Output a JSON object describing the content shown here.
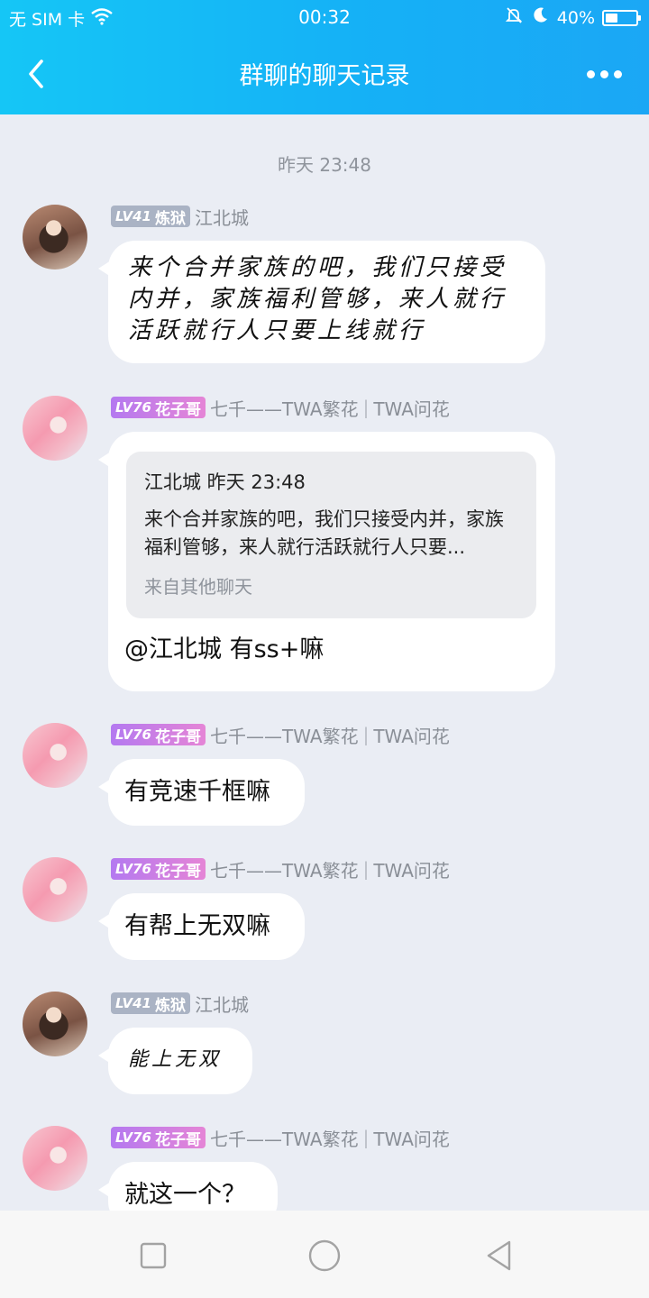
{
  "status_bar": {
    "carrier": "无 SIM 卡",
    "time": "00:32",
    "battery": "40%",
    "battery_level": 0.4
  },
  "nav": {
    "title": "群聊的聊天记录",
    "back_icon": "chevron-left-icon",
    "more_icon": "more-dots-icon"
  },
  "chat": {
    "time_separator": "昨天 23:48",
    "messages": [
      {
        "level": "LV41",
        "badge_name": "炼狱",
        "sender": "江北城",
        "text": "来个合并家族的吧，我们只接受内并，家族福利管够，来人就行活跃就行人只要上线就行"
      },
      {
        "level": "LV76",
        "badge_name": "花子哥",
        "sender": "七千——TWA繁花",
        "sender_extra": "TWA问花",
        "quote": {
          "header": "江北城 昨天 23:48",
          "body": "来个合并家族的吧，我们只接受内并，家族福利管够，来人就行活跃就行人只要...",
          "source": "来自其他聊天"
        },
        "text": "@江北城 有ss+嘛"
      },
      {
        "level": "LV76",
        "badge_name": "花子哥",
        "sender": "七千——TWA繁花",
        "sender_extra": "TWA问花",
        "text": "有竞速千框嘛"
      },
      {
        "level": "LV76",
        "badge_name": "花子哥",
        "sender": "七千——TWA繁花",
        "sender_extra": "TWA问花",
        "text": "有帮上无双嘛"
      },
      {
        "level": "LV41",
        "badge_name": "炼狱",
        "sender": "江北城",
        "text": "能上无双"
      },
      {
        "level": "LV76",
        "badge_name": "花子哥",
        "sender": "七千——TWA繁花",
        "sender_extra": "TWA问花",
        "text": "就这一个？"
      }
    ]
  },
  "system_nav": {
    "recent_icon": "square-recent-apps-icon",
    "home_icon": "circle-home-icon",
    "back_icon": "triangle-back-icon"
  }
}
